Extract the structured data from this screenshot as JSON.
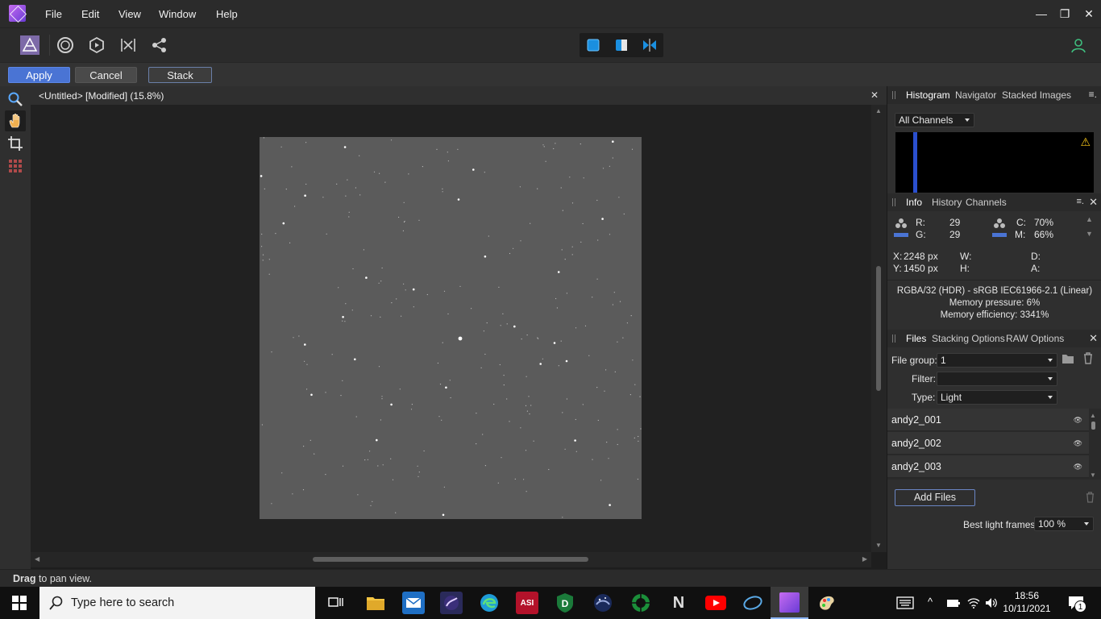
{
  "menubar": {
    "items": [
      "File",
      "Edit",
      "View",
      "Window",
      "Help"
    ],
    "window_controls": [
      "—",
      "❐",
      "✕"
    ]
  },
  "context_bar": {
    "apply_label": "Apply",
    "cancel_label": "Cancel",
    "stack_label": "Stack"
  },
  "document": {
    "title": "<Untitled> [Modified] (15.8%)",
    "close_glyph": "✕"
  },
  "status": {
    "bold": "Drag",
    "rest": " to pan view."
  },
  "histogram_panel": {
    "tabs": [
      "Histogram",
      "Navigator",
      "Stacked Images"
    ],
    "channel_select": "All Channels",
    "warning_glyph": "⚠"
  },
  "info_panel": {
    "tabs": [
      "Info",
      "History",
      "Channels"
    ],
    "r_label": "R:",
    "r_value": "29",
    "g_label": "G:",
    "g_value": "29",
    "c_label": "C:",
    "c_value": "70%",
    "m_label": "M:",
    "m_value": "66%",
    "x_label": "X:",
    "x_value": "2248 px",
    "y_label": "Y:",
    "y_value": "1450 px",
    "w_label": "W:",
    "h_label": "H:",
    "d_label": "D:",
    "a_label": "A:",
    "color_format": "RGBA/32 (HDR) - sRGB IEC61966-2.1 (Linear)",
    "memory_pressure": "Memory pressure: 6%",
    "memory_efficiency": "Memory efficiency: 3341%"
  },
  "files_panel": {
    "tabs": [
      "Files",
      "Stacking Options",
      "RAW Options"
    ],
    "file_group_label": "File group:",
    "file_group_value": "1",
    "filter_label": "Filter:",
    "filter_value": "",
    "type_label": "Type:",
    "type_value": "Light",
    "files": [
      "andy2_001",
      "andy2_002",
      "andy2_003"
    ],
    "add_files_label": "Add Files",
    "best_frames_label": "Best light frames:",
    "best_frames_value": "100 %"
  },
  "taskbar": {
    "search_placeholder": "Type here to search",
    "time": "18:56",
    "date": "10/11/2021",
    "notification_count": "1",
    "apps": [
      "task-view",
      "file-explorer",
      "mail",
      "deep-sky-stacker",
      "edge",
      "asi-studio",
      "d-app",
      "nina",
      "sharpcap",
      "n-app",
      "youtube",
      "cortana",
      "affinity-photo",
      "paint"
    ]
  },
  "colors": {
    "accent_blue": "#4a74d4",
    "panel": "#2f2f2f",
    "canvas": "#212121",
    "image": "#5b5b5b"
  }
}
